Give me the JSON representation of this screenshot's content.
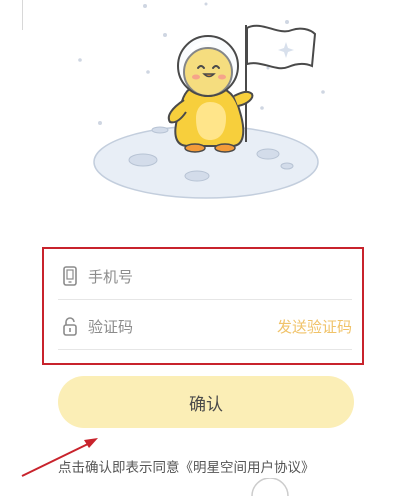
{
  "login": {
    "phone_placeholder": "手机号",
    "code_placeholder": "验证码",
    "send_code_label": "发送验证码",
    "confirm_label": "确认",
    "agreement_text": "点击确认即表示同意《明星空间用户协议》"
  },
  "icons": {
    "phone": "phone-icon",
    "lock": "lock-icon",
    "mascot": "astronaut-penguin-illustration",
    "flag": "flag-icon"
  },
  "colors": {
    "highlight_border": "#c8232c",
    "send_code": "#f0c36a",
    "confirm_button_bg": "#fbeeb6",
    "mascot_yellow": "#f7cf3c",
    "moon": "#e8eef6",
    "arrow": "#c8232c"
  }
}
